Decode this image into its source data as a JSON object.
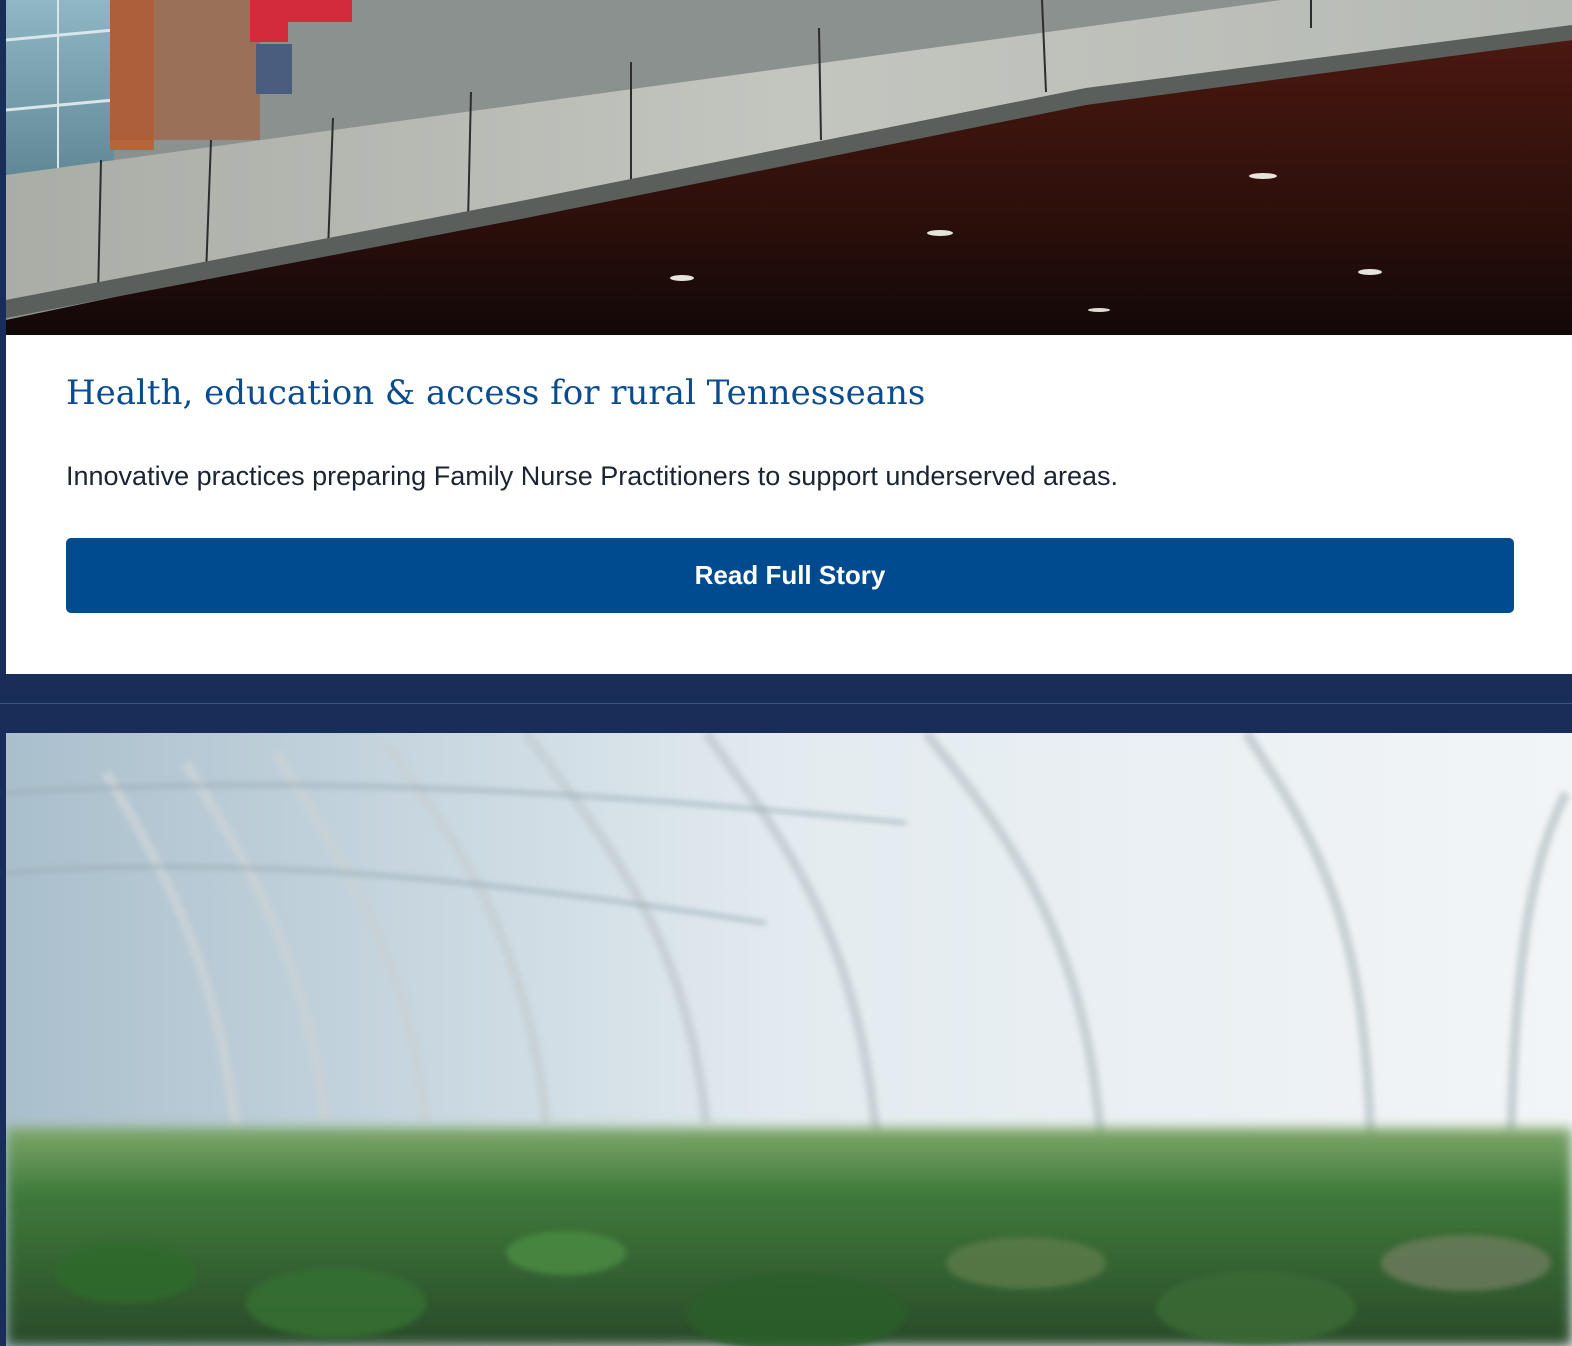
{
  "story": {
    "title": "Health, education & access for rural Tennesseans",
    "summary": "Innovative practices preparing Family Nurse Practitioners to support underserved areas.",
    "button_label": "Read Full Story"
  },
  "colors": {
    "background_navy": "#182d57",
    "title_blue": "#0b4c8f",
    "button_blue": "#004a8f",
    "body_text": "#1b2433"
  },
  "images": {
    "story_photo": "building-exterior-photo",
    "next_photo": "greenhouse-photo"
  }
}
